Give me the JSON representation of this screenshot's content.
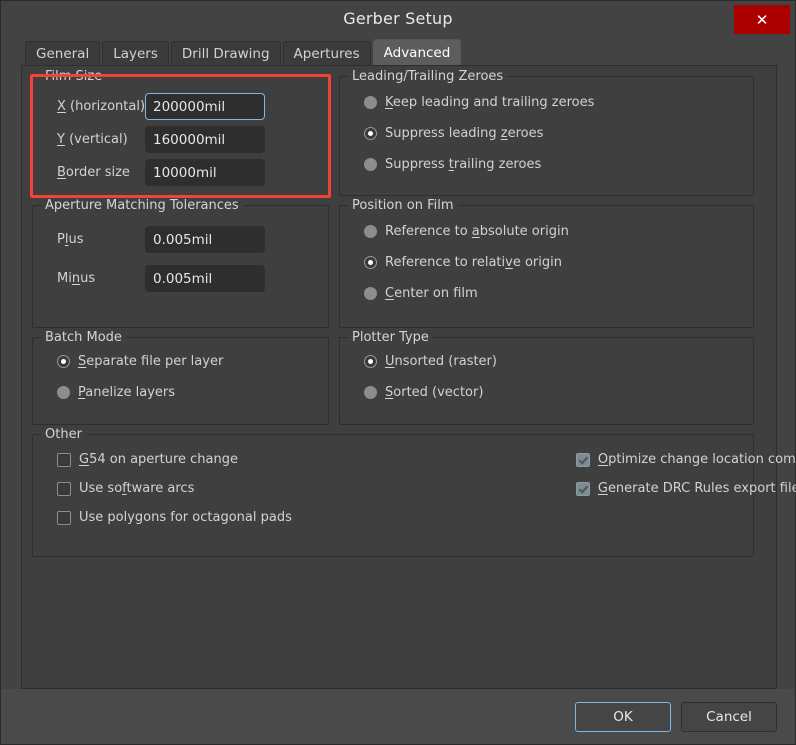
{
  "window": {
    "title": "Gerber Setup",
    "close_label": "✕"
  },
  "tabs": [
    {
      "label": "General",
      "active": false
    },
    {
      "label": "Layers",
      "active": false
    },
    {
      "label": "Drill Drawing",
      "active": false
    },
    {
      "label": "Apertures",
      "active": false
    },
    {
      "label": "Advanced",
      "active": true
    }
  ],
  "film_size": {
    "legend": "Film Size",
    "fields": [
      {
        "label_prefix": "X",
        "label_rest": " (horizontal)",
        "value": "200000mil",
        "focused": true
      },
      {
        "label_prefix": "Y",
        "label_rest": " (vertical)",
        "value": "160000mil",
        "focused": false
      },
      {
        "label_prefix": "B",
        "label_rest": "order size",
        "value": "10000mil",
        "focused": false
      }
    ]
  },
  "aperture_tolerances": {
    "legend": "Aperture Matching Tolerances",
    "fields": [
      {
        "label_a": "P",
        "label_key": "l",
        "label_b": "us",
        "value": "0.005mil"
      },
      {
        "label_a": "Mi",
        "label_key": "n",
        "label_b": "us",
        "value": "0.005mil"
      }
    ]
  },
  "batch_mode": {
    "legend": "Batch Mode",
    "options": [
      {
        "pre": "",
        "key": "S",
        "post": "eparate file per layer",
        "selected": true
      },
      {
        "pre": "",
        "key": "P",
        "post": "anelize layers",
        "selected": false
      }
    ]
  },
  "zeroes": {
    "legend": "Leading/Trailing Zeroes",
    "options": [
      {
        "pre": "",
        "key": "K",
        "post": "eep leading and trailing zeroes",
        "selected": false
      },
      {
        "pre": "Suppress leading ",
        "key": "z",
        "post": "eroes",
        "selected": true
      },
      {
        "pre": "Suppress ",
        "key": "t",
        "post": "railing zeroes",
        "selected": false
      }
    ]
  },
  "position_on_film": {
    "legend": "Position on Film",
    "options": [
      {
        "pre": "Reference to ",
        "key": "a",
        "post": "bsolute origin",
        "selected": false
      },
      {
        "pre": "Reference to relati",
        "key": "v",
        "post": "e origin",
        "selected": true
      },
      {
        "pre": "",
        "key": "C",
        "post": "enter on film",
        "selected": false
      }
    ]
  },
  "plotter_type": {
    "legend": "Plotter Type",
    "options": [
      {
        "pre": "",
        "key": "U",
        "post": "nsorted (raster)",
        "selected": true
      },
      {
        "pre": "",
        "key": "S",
        "post": "orted (vector)",
        "selected": false
      }
    ]
  },
  "other": {
    "legend": "Other",
    "left": [
      {
        "pre": "",
        "key": "G",
        "post": "54 on aperture change",
        "checked": false
      },
      {
        "pre": "Use so",
        "key": "f",
        "post": "tware arcs",
        "checked": false
      },
      {
        "pre": "Use polygons for octagonal pads",
        "key": "",
        "post": "",
        "checked": false
      }
    ],
    "right": [
      {
        "pre": "",
        "key": "O",
        "post": "ptimize change location commands",
        "checked": true
      },
      {
        "pre": "",
        "key": "G",
        "post": "enerate DRC Rules export file (.RUL)",
        "checked": true
      }
    ]
  },
  "buttons": {
    "ok": "OK",
    "cancel": "Cancel"
  },
  "annotation": {
    "highlight_target": "film-size-group",
    "color": "#f44336"
  }
}
